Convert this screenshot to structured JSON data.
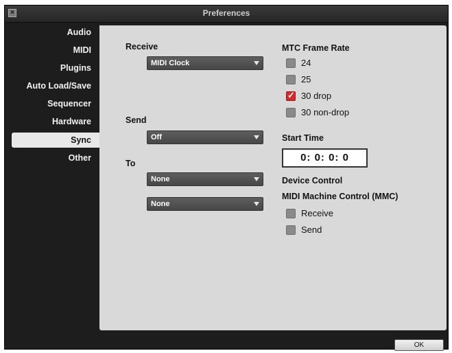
{
  "window": {
    "title": "Preferences",
    "close_glyph": "×"
  },
  "sidebar": {
    "items": [
      {
        "label": "Audio"
      },
      {
        "label": "MIDI"
      },
      {
        "label": "Plugins"
      },
      {
        "label": "Auto Load/Save"
      },
      {
        "label": "Sequencer"
      },
      {
        "label": "Hardware"
      },
      {
        "label": "Sync",
        "selected": true
      },
      {
        "label": "Other"
      }
    ]
  },
  "receive": {
    "label": "Receive",
    "value": "MIDI Clock"
  },
  "send": {
    "label": "Send",
    "value": "Off"
  },
  "to": {
    "label": "To",
    "dest1": "None",
    "dest2": "None"
  },
  "mtc": {
    "label": "MTC Frame Rate",
    "options": [
      {
        "label": "24",
        "checked": false
      },
      {
        "label": "25",
        "checked": false
      },
      {
        "label": "30 drop",
        "checked": true
      },
      {
        "label": "30 non-drop",
        "checked": false
      }
    ]
  },
  "start_time": {
    "label": "Start Time",
    "value": "0:  0:  0:  0"
  },
  "device_control": {
    "label": "Device Control",
    "mmc_label": "MIDI Machine Control (MMC)",
    "options": [
      {
        "label": "Receive",
        "checked": false
      },
      {
        "label": "Send",
        "checked": false
      }
    ]
  },
  "footer": {
    "ok_label": "OK"
  },
  "colors": {
    "accent_check": "#d42a2a",
    "window_bg": "#1d1d1d",
    "panel_bg": "#d9d9d9"
  }
}
